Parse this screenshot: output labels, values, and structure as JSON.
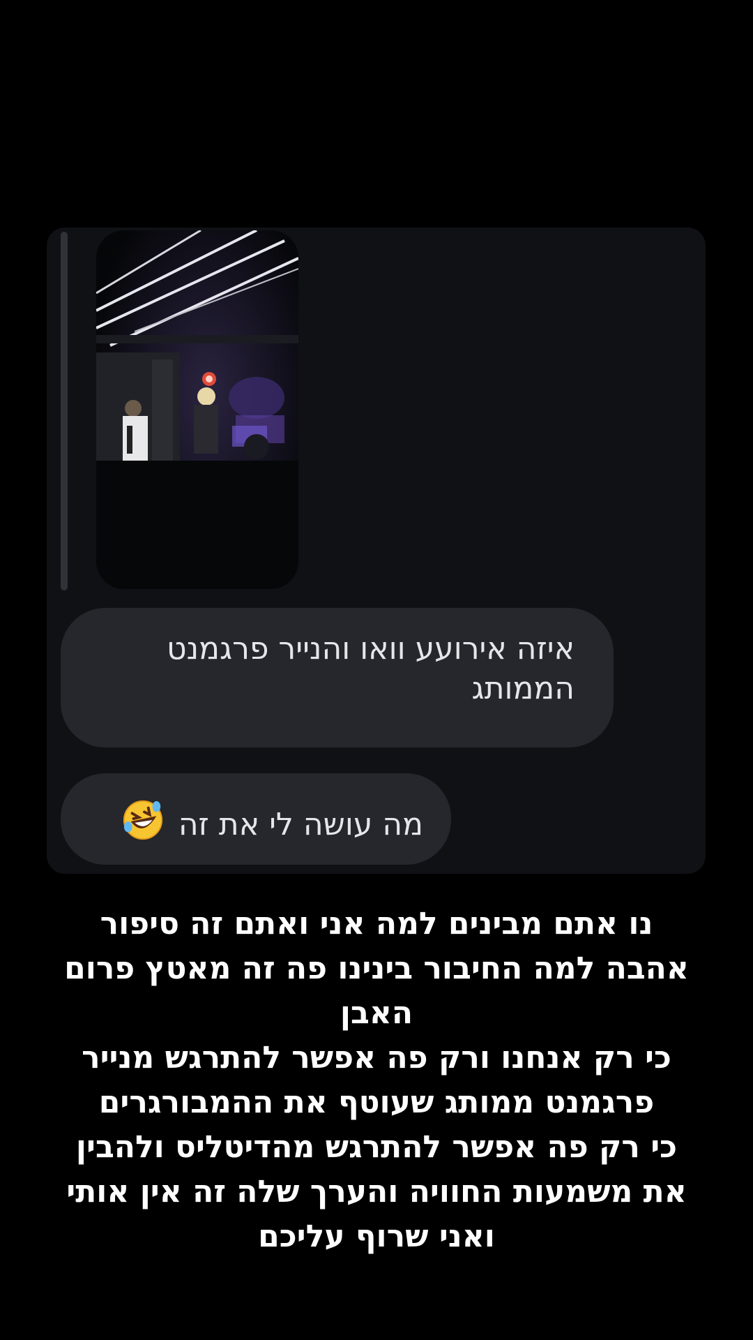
{
  "reply": {
    "story_thumbnail_icon": "concert-stage-photo"
  },
  "messages": [
    {
      "text": "איזה אירועע וואו והנייר פרגמנט הממותג"
    },
    {
      "text": "מה עושה לי את זה",
      "emoji_icon": "rolling-on-floor-laughing-icon"
    }
  ],
  "caption": {
    "lines": [
      "נו אתם מבינים למה אני ואתם זה סיפור",
      "אהבה למה החיבור בינינו פה זה מאטץ פרום",
      "האבן",
      "כי רק אנחנו ורק פה אפשר להתרגש מנייר",
      "פרגמנט ממותג שעוטף את ההמבורגרים",
      "כי רק פה אפשר להתרגש מהדיטליס ולהבין",
      "את משמעות החוויה והערך שלה זה  אין אותי",
      "ואני שרוף עליכם"
    ]
  },
  "colors": {
    "background": "#000000",
    "card": "#0f1115",
    "bubble": "#25272c",
    "text": "#ffffff"
  }
}
